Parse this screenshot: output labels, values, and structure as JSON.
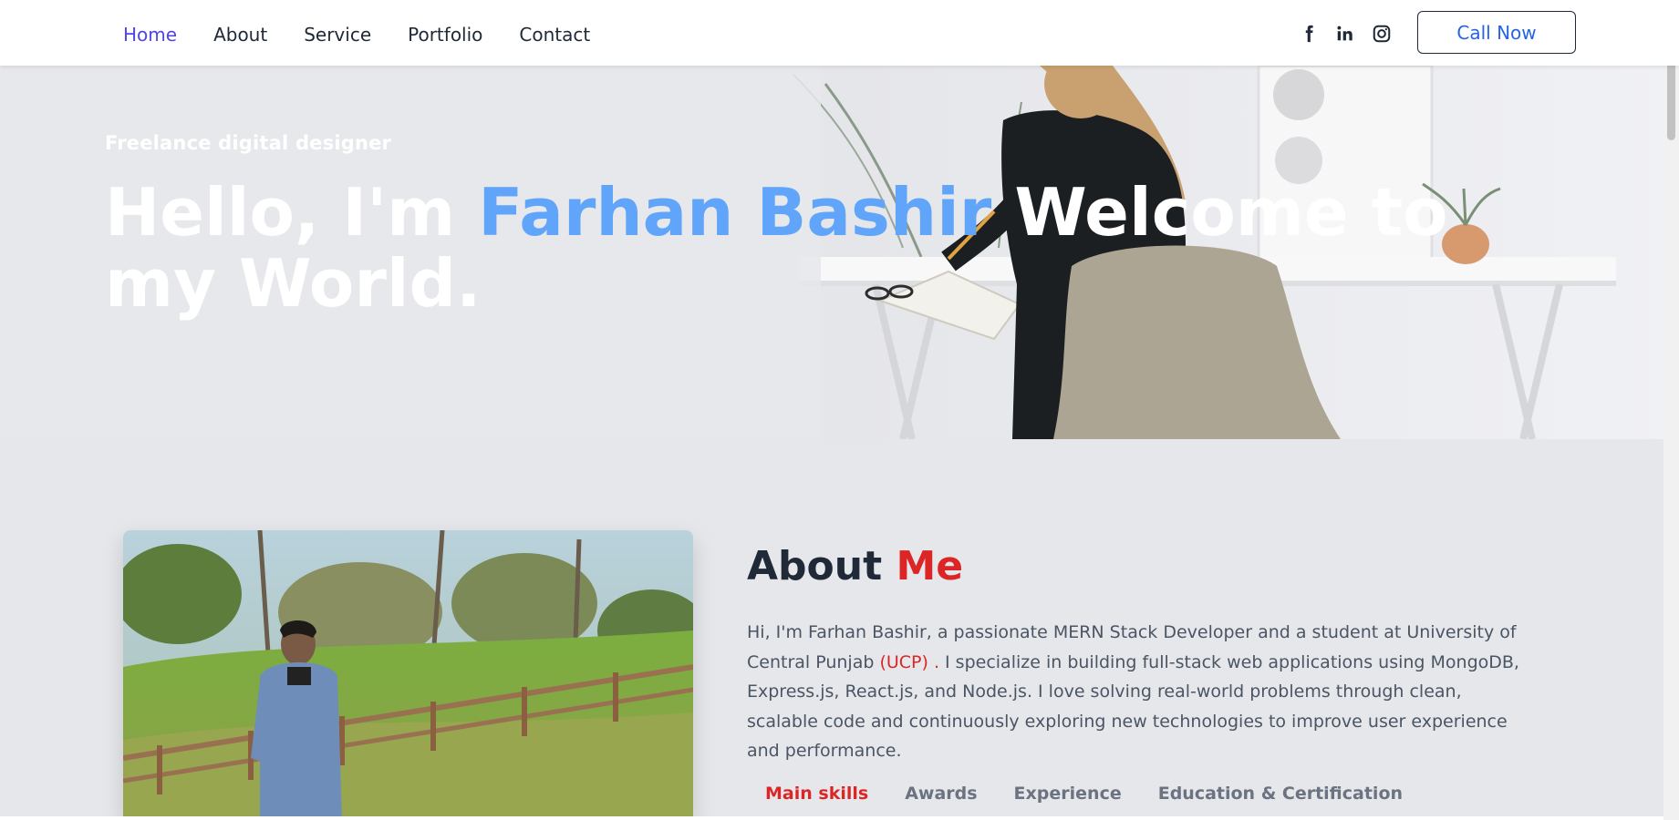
{
  "nav": {
    "items": [
      {
        "label": "Home",
        "active": true
      },
      {
        "label": "About",
        "active": false
      },
      {
        "label": "Service",
        "active": false
      },
      {
        "label": "Portfolio",
        "active": false
      },
      {
        "label": "Contact",
        "active": false
      }
    ],
    "social_icons": [
      "facebook-icon",
      "linkedin-icon",
      "instagram-icon"
    ],
    "call_label": "Call Now"
  },
  "hero": {
    "subtitle": "Freelance digital designer",
    "title_prefix": "Hello, I'm ",
    "title_name": "Farhan Bashir",
    "title_suffix": " Welcome to my World."
  },
  "about": {
    "title_main": "About ",
    "title_accent": "Me",
    "text_before": "Hi, I'm Farhan Bashir, a passionate MERN Stack Developer and a student at University of Central Punjab ",
    "text_ucp": "(UCP) .",
    "text_after": " I specialize in building full-stack web applications using MongoDB, Express.js, React.js, and Node.js. I love solving real-world problems through clean, scalable code and continuously exploring new technologies to improve user experience and performance.",
    "tabs": [
      {
        "label": "Main skills",
        "active": true
      },
      {
        "label": "Awards",
        "active": false
      },
      {
        "label": "Experience",
        "active": false
      },
      {
        "label": "Education & Certification",
        "active": false
      }
    ]
  },
  "colors": {
    "accent_nav": "#4f46e5",
    "name_blue": "#60a5fa",
    "accent_red": "#dc2626"
  }
}
